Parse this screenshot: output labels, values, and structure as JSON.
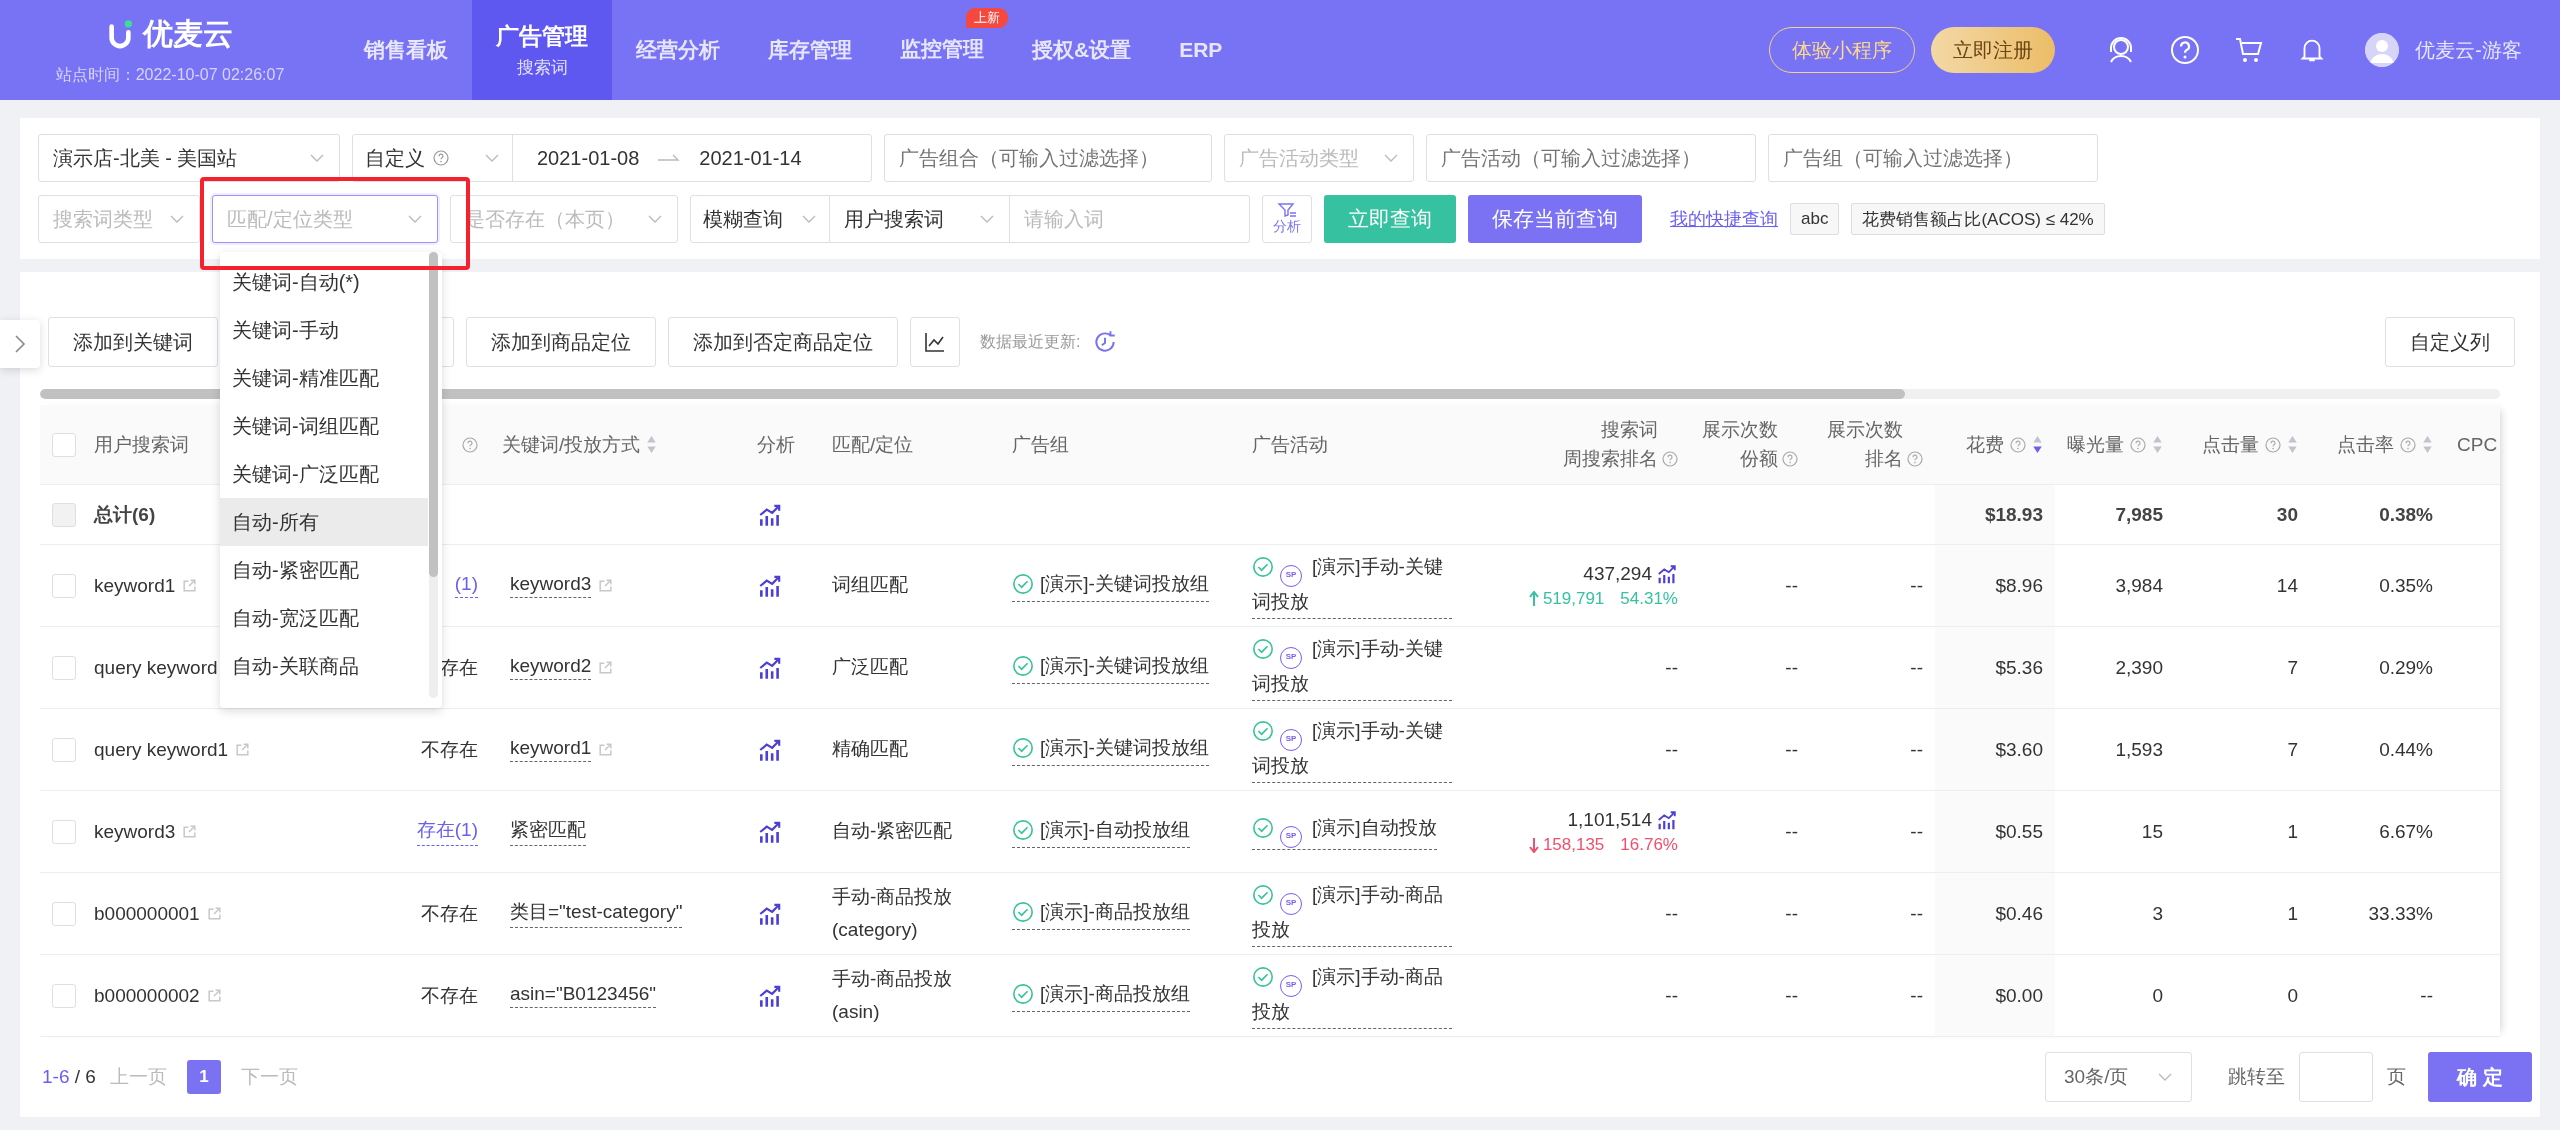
{
  "nav": {
    "logo": "优麦云",
    "site_time": "站点时间：2022-10-07 02:26:07",
    "menu": [
      {
        "label": "销售看板",
        "selected": false
      },
      {
        "label": "广告管理",
        "sub": "搜索词",
        "selected": true
      },
      {
        "label": "经营分析",
        "selected": false
      },
      {
        "label": "库存管理",
        "selected": false
      },
      {
        "label": "监控管理",
        "selected": false,
        "badge": "上新"
      },
      {
        "label": "授权&设置",
        "selected": false
      },
      {
        "label": "ERP",
        "selected": false
      }
    ],
    "trial_button": "体验小程序",
    "register_button": "立即注册",
    "user": "优麦云-游客"
  },
  "filters": {
    "row1": [
      {
        "kind": "select",
        "value": "演示店-北美 - 美国站"
      },
      {
        "kind": "daterange",
        "value": "自定义",
        "start": "2021-01-08",
        "end": "2021-01-14"
      },
      {
        "kind": "input",
        "placeholder": "广告组合（可输入过滤选择）"
      },
      {
        "kind": "select",
        "placeholder": "广告活动类型"
      },
      {
        "kind": "input",
        "placeholder": "广告活动（可输入过滤选择）"
      },
      {
        "kind": "input",
        "placeholder": "广告组（可输入过滤选择）"
      }
    ],
    "row2": [
      {
        "kind": "select",
        "placeholder": "搜索词类型",
        "focused": false
      },
      {
        "kind": "select",
        "placeholder": "匹配/定位类型",
        "focused": true
      },
      {
        "kind": "select",
        "placeholder": "是否存在（本页）",
        "focused": false
      },
      {
        "kind": "search",
        "mode": "模糊查询",
        "field": "用户搜索词",
        "placeholder": "请输入词"
      }
    ],
    "analyze_button": "分析",
    "query_button": "立即查询",
    "save_button": "保存当前查询",
    "quick_link": "我的快捷查询",
    "chips": [
      "abc",
      "花费销售额占比(ACOS) ≤ 42%"
    ]
  },
  "dropdown": {
    "options": [
      {
        "label": "关键词-自动(*)",
        "selected": false
      },
      {
        "label": "关键词-手动",
        "selected": false
      },
      {
        "label": "关键词-精准匹配",
        "selected": false
      },
      {
        "label": "关键词-词组匹配",
        "selected": false
      },
      {
        "label": "关键词-广泛匹配",
        "selected": false
      },
      {
        "label": "自动-所有",
        "selected": true
      },
      {
        "label": "自动-紧密匹配",
        "selected": false
      },
      {
        "label": "自动-宽泛匹配",
        "selected": false
      },
      {
        "label": "自动-关联商品",
        "selected": false
      }
    ]
  },
  "toolbar": {
    "buttons": [
      {
        "kind": "button",
        "label": "添加到关键词"
      },
      {
        "kind": "covered"
      },
      {
        "kind": "button",
        "label": "添加到商品定位"
      },
      {
        "kind": "button",
        "label": "添加到否定商品定位"
      },
      {
        "kind": "chart"
      }
    ],
    "update_label": "数据最近更新:",
    "columns_button": "自定义列"
  },
  "table": {
    "select_all_checked": false,
    "columns": [
      {
        "kind": "term",
        "label": "用户搜索词"
      },
      {
        "kind": "exists",
        "help": true
      },
      {
        "kind": "keyword",
        "label": "关键词/投放方式",
        "sortable": true,
        "sort_active": false
      },
      {
        "kind": "analysis",
        "label": "分析"
      },
      {
        "kind": "match",
        "label": "匹配/定位"
      },
      {
        "kind": "group",
        "label": "广告组"
      },
      {
        "kind": "campaign",
        "label": "广告活动"
      },
      {
        "kind": "rank",
        "lines": [
          "搜索词",
          "周搜索排名"
        ],
        "help": true
      },
      {
        "kind": "share",
        "lines": [
          "展示次数",
          "份额"
        ],
        "help": true
      },
      {
        "kind": "share_rank",
        "lines": [
          "展示次数",
          "排名"
        ],
        "help": true
      },
      {
        "kind": "spend",
        "label": "花费",
        "help": true,
        "sortable": true,
        "sort_active": true
      },
      {
        "kind": "impressions",
        "label": "曝光量",
        "help": true,
        "sortable": true,
        "sort_active": false
      },
      {
        "kind": "clicks",
        "label": "点击量",
        "help": true,
        "sortable": true,
        "sort_active": false
      },
      {
        "kind": "ctr",
        "label": "点击率",
        "help": true,
        "sortable": true,
        "sort_active": false
      },
      {
        "kind": "cpc",
        "label": "CPC"
      }
    ],
    "total": {
      "label": "总计(6)",
      "checked": false,
      "disabled": true,
      "spend": "$18.93",
      "impressions": "7,985",
      "clicks": "30",
      "ctr": "0.38%"
    },
    "rows": [
      {
        "checked": false,
        "term": "keyword1",
        "term_link_icon": true,
        "exists": "(1)",
        "exists_linked": true,
        "keyword": "keyword3",
        "keyword_link_icon": true,
        "match": "词组匹配",
        "ad_group": "[演示]-关键词投放组",
        "campaign_badge": "SP",
        "campaign": "[演示]手动-关键词投放",
        "rank": {
          "value": "437,294",
          "chart_icon": true,
          "rising": true,
          "change": "519,791",
          "pct": "54.31%"
        },
        "share": "--",
        "share_rank": "--",
        "spend": "$8.96",
        "impressions": "3,984",
        "clicks": "14",
        "ctr": "0.35%"
      },
      {
        "checked": false,
        "term": "query keyword",
        "term_link_icon": false,
        "exists": "存在",
        "exists_linked": false,
        "keyword": "keyword2",
        "keyword_link_icon": true,
        "match": "广泛匹配",
        "ad_group": "[演示]-关键词投放组",
        "campaign_badge": "SP",
        "campaign": "[演示]手动-关键词投放",
        "rank": {
          "value": "--",
          "chart_icon": false
        },
        "share": "--",
        "share_rank": "--",
        "spend": "$5.36",
        "impressions": "2,390",
        "clicks": "7",
        "ctr": "0.29%"
      },
      {
        "checked": false,
        "term": "query keyword1",
        "term_link_icon": true,
        "exists": "不存在",
        "exists_linked": false,
        "keyword": "keyword1",
        "keyword_link_icon": true,
        "match": "精确匹配",
        "ad_group": "[演示]-关键词投放组",
        "campaign_badge": "SP",
        "campaign": "[演示]手动-关键词投放",
        "rank": {
          "value": "--",
          "chart_icon": false
        },
        "share": "--",
        "share_rank": "--",
        "spend": "$3.60",
        "impressions": "1,593",
        "clicks": "7",
        "ctr": "0.44%"
      },
      {
        "checked": false,
        "term": "keyword3",
        "term_link_icon": true,
        "exists": "存在(1)",
        "exists_linked": true,
        "keyword": "紧密匹配",
        "keyword_link_icon": false,
        "match": "自动-紧密匹配",
        "ad_group": "[演示]-自动投放组",
        "campaign_badge": "SP",
        "campaign": "[演示]自动投放",
        "rank": {
          "value": "1,101,514",
          "chart_icon": true,
          "rising": false,
          "change": "158,135",
          "pct": "16.76%"
        },
        "share": "--",
        "share_rank": "--",
        "spend": "$0.55",
        "impressions": "15",
        "clicks": "1",
        "ctr": "6.67%"
      },
      {
        "checked": false,
        "term": "b000000001",
        "term_link_icon": true,
        "exists": "不存在",
        "exists_linked": false,
        "keyword": "类目=\"test-category\"",
        "keyword_link_icon": false,
        "match": "手动-商品投放 (category)",
        "ad_group": "[演示]-商品投放组",
        "campaign_badge": "SP",
        "campaign": "[演示]手动-商品投放",
        "rank": {
          "value": "--",
          "chart_icon": false
        },
        "share": "--",
        "share_rank": "--",
        "spend": "$0.46",
        "impressions": "3",
        "clicks": "1",
        "ctr": "33.33%"
      },
      {
        "checked": false,
        "term": "b000000002",
        "term_link_icon": true,
        "exists": "不存在",
        "exists_linked": false,
        "keyword": "asin=\"B0123456\"",
        "keyword_link_icon": false,
        "match": "手动-商品投放 (asin)",
        "ad_group": "[演示]-商品投放组",
        "campaign_badge": "SP",
        "campaign": "[演示]手动-商品投放",
        "rank": {
          "value": "--",
          "chart_icon": false
        },
        "share": "--",
        "share_rank": "--",
        "spend": "$0.00",
        "impressions": "0",
        "clicks": "0",
        "ctr": "--"
      }
    ]
  },
  "pagination": {
    "range": "1-6",
    "total": "/ 6",
    "prev": "上一页",
    "prev_disabled": true,
    "pages": [
      {
        "label": "1",
        "selected": true
      }
    ],
    "next": "下一页",
    "next_disabled": true,
    "page_size": "30条/页",
    "jump_label": "跳转至",
    "page_unit": "页",
    "confirm": "确 定"
  }
}
